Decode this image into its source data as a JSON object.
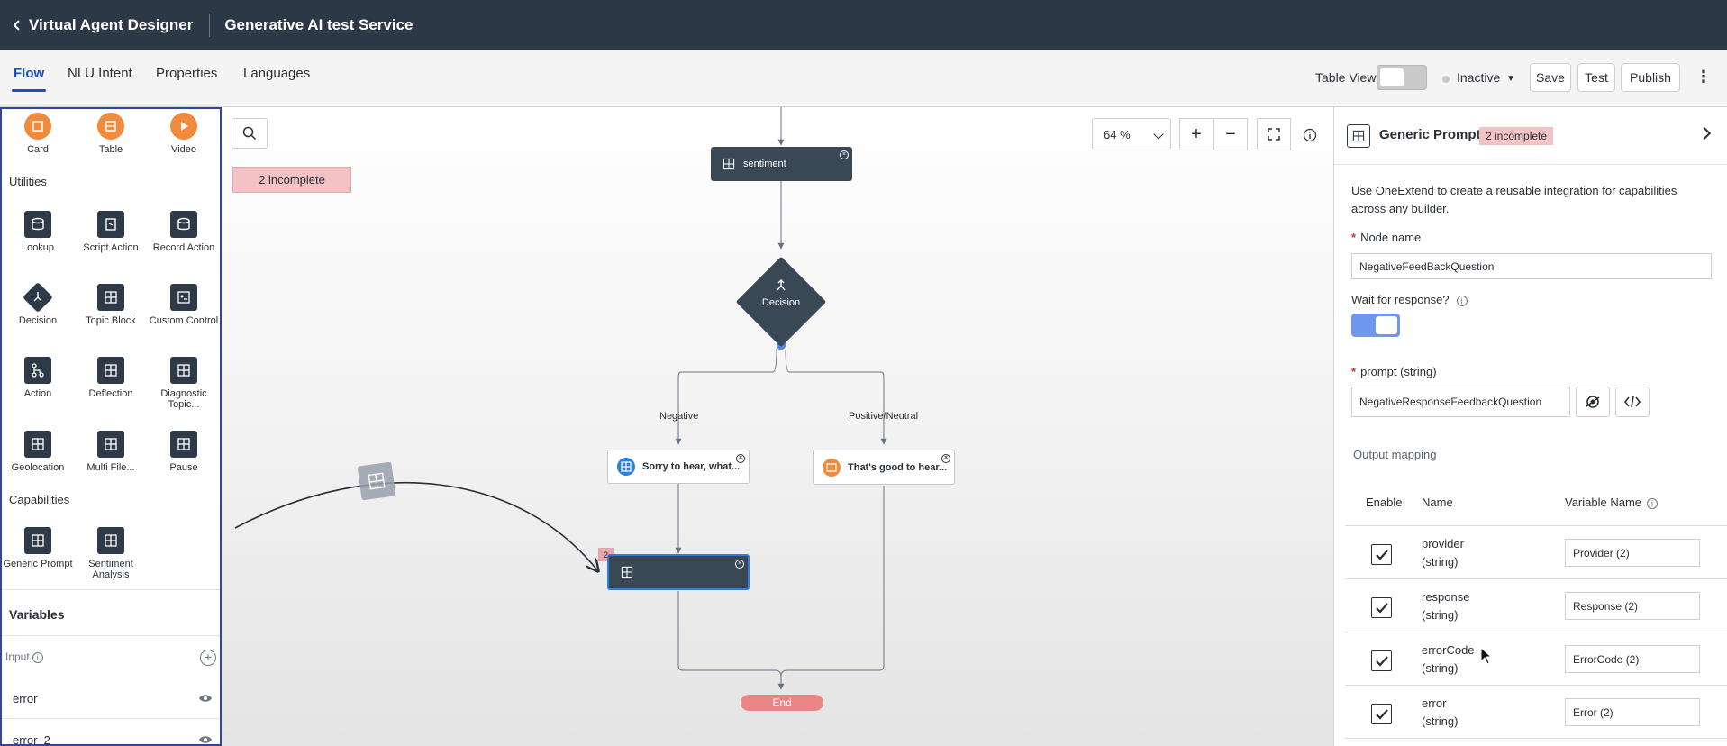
{
  "topbar": {
    "app_title": "Virtual Agent Designer",
    "service_title": "Generative AI test Service"
  },
  "tabs": [
    {
      "label": "Flow",
      "active": true
    },
    {
      "label": "NLU Intent",
      "active": false
    },
    {
      "label": "Properties",
      "active": false
    },
    {
      "label": "Languages",
      "active": false
    }
  ],
  "toolbar": {
    "table_view_label": "Table View",
    "table_view_on": false,
    "status_label": "Inactive",
    "save_label": "Save",
    "test_label": "Test",
    "publish_label": "Publish"
  },
  "palette": {
    "top_items": [
      "Card",
      "Table",
      "Video"
    ],
    "utilities_heading": "Utilities",
    "utilities": [
      {
        "label": "Lookup",
        "icon": "database-icon"
      },
      {
        "label": "Script Action",
        "icon": "script-icon"
      },
      {
        "label": "Record Action",
        "icon": "record-icon"
      },
      {
        "label": "Decision",
        "icon": "decision-icon"
      },
      {
        "label": "Topic Block",
        "icon": "grid-icon"
      },
      {
        "label": "Custom Control",
        "icon": "custom-control-icon"
      },
      {
        "label": "Action",
        "icon": "action-icon"
      },
      {
        "label": "Deflection",
        "icon": "grid-icon"
      },
      {
        "label": "Diagnostic Topic...",
        "icon": "grid-icon"
      },
      {
        "label": "Geolocation",
        "icon": "grid-icon"
      },
      {
        "label": "Multi File...",
        "icon": "grid-icon"
      },
      {
        "label": "Pause",
        "icon": "grid-icon"
      }
    ],
    "capabilities_heading": "Capabilities",
    "capabilities": [
      {
        "label": "Generic Prompt",
        "icon": "grid-icon"
      },
      {
        "label": "Sentiment Analysis",
        "icon": "grid-icon"
      }
    ],
    "variables_heading": "Variables",
    "input_label": "Input",
    "variables": [
      "error",
      "error_2"
    ]
  },
  "canvas": {
    "incomplete_banner": "2 incomplete",
    "zoom": "64 %",
    "nodes": {
      "sentiment": "sentiment",
      "decision": "Decision",
      "negative_branch": "Negative",
      "positive_branch": "Positive/Neutral",
      "sorry_node": "Sorry to hear, what...",
      "good_node": "That's good to hear...",
      "new_node_badge": "2",
      "end": "End"
    }
  },
  "properties": {
    "title": "Generic Prompt",
    "badge": "2 incomplete",
    "description": "Use OneExtend to create a reusable integration for capabilities across any builder.",
    "node_name_label": "Node name",
    "node_name_value": "NegativeFeedBackQuestion",
    "wait_label": "Wait for response?",
    "wait_on": true,
    "prompt_label": "prompt  (string)",
    "prompt_value": "NegativeResponseFeedbackQuestion",
    "output_mapping_label": "Output mapping",
    "columns": {
      "enable": "Enable",
      "name": "Name",
      "variable": "Variable Name"
    },
    "rows": [
      {
        "name": "provider",
        "type": "(string)",
        "variable": "Provider (2)",
        "enabled": true
      },
      {
        "name": "response",
        "type": "(string)",
        "variable": "Response (2)",
        "enabled": true
      },
      {
        "name": "errorCode",
        "type": "(string)",
        "variable": "ErrorCode (2)",
        "enabled": true
      },
      {
        "name": "error",
        "type": "(string)",
        "variable": "Error (2)",
        "enabled": true
      }
    ]
  },
  "colors": {
    "topbar_bg": "#2c3845",
    "accent_blue": "#1b4fbf",
    "node_dark": "#3a4755",
    "incomplete_pink": "#f2c2c5",
    "end_red": "#e88686",
    "palette_orange": "#f08a3c",
    "toggle_on": "#6f97ee"
  }
}
